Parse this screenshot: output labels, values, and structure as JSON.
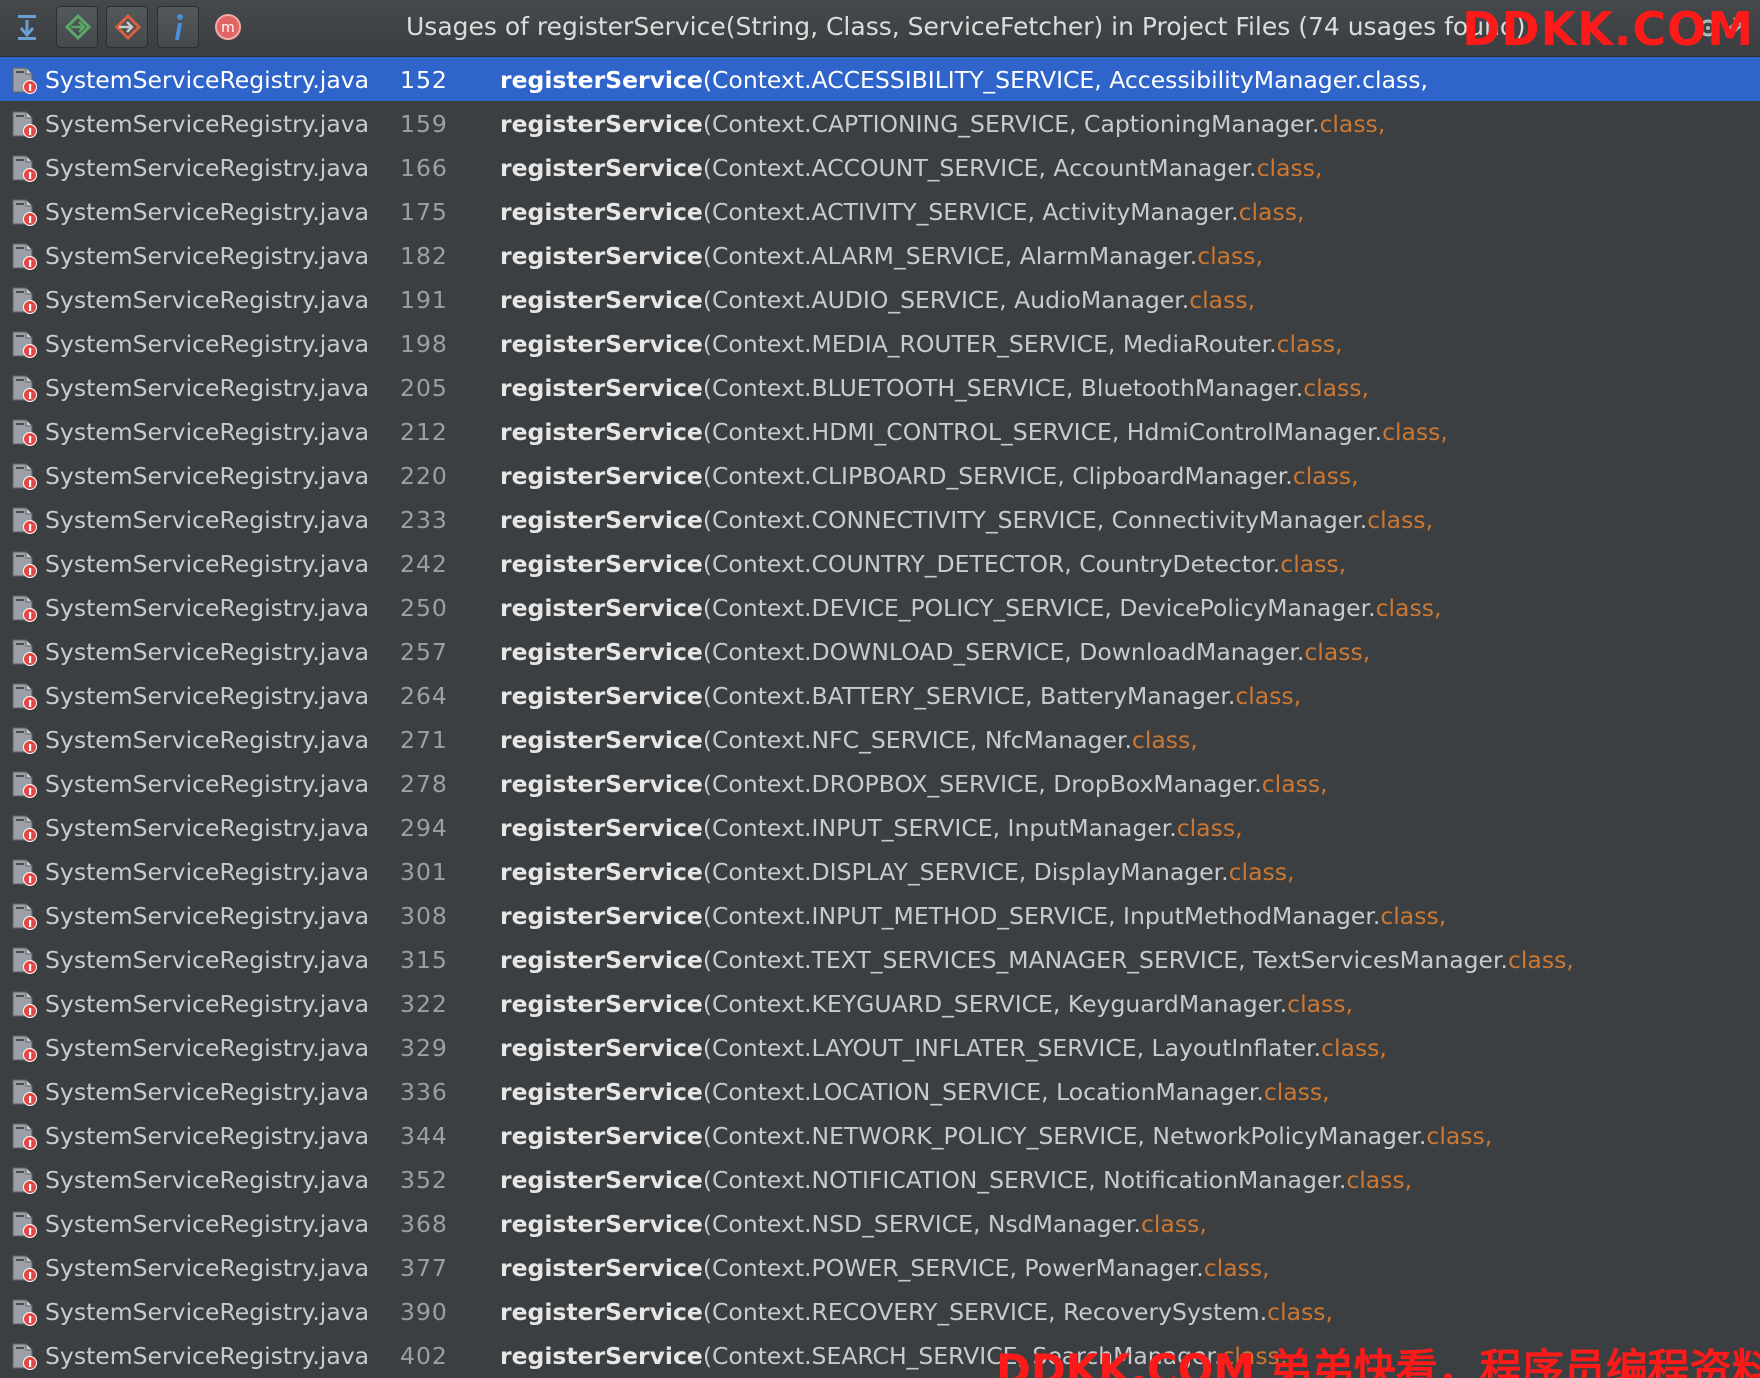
{
  "popup": {
    "title": "Usages of registerService(String, Class, ServiceFetcher) in Project Files (74 usages found)"
  },
  "toolbar": {
    "buttons": [
      {
        "name": "collapse-all-icon",
        "color": "#6a9fd4"
      },
      {
        "name": "go-to-next-icon",
        "color": "#59a869"
      },
      {
        "name": "go-to-previous-icon",
        "color": "#d9603f"
      },
      {
        "name": "info-icon",
        "color": "#4a8fd8"
      },
      {
        "name": "method-icon",
        "color": "#e06666"
      }
    ]
  },
  "watermarks": {
    "top": "DDKK.COM",
    "bottom": "DDKK.COM 弟弟快看，程序员编程资料站"
  },
  "colors": {
    "selection": "#2f65ca",
    "keyword": "#cc7832",
    "background": "#3c3f41"
  },
  "usages": [
    {
      "file": "SystemServiceRegistry.java",
      "line": "152",
      "method": "registerService",
      "args": "(Context.ACCESSIBILITY_SERVICE, AccessibilityManager.",
      "kw": "class",
      "tail": ",",
      "selected": true
    },
    {
      "file": "SystemServiceRegistry.java",
      "line": "159",
      "method": "registerService",
      "args": "(Context.CAPTIONING_SERVICE, CaptioningManager.",
      "kw": "class",
      "tail": ","
    },
    {
      "file": "SystemServiceRegistry.java",
      "line": "166",
      "method": "registerService",
      "args": "(Context.ACCOUNT_SERVICE, AccountManager.",
      "kw": "class",
      "tail": ","
    },
    {
      "file": "SystemServiceRegistry.java",
      "line": "175",
      "method": "registerService",
      "args": "(Context.ACTIVITY_SERVICE, ActivityManager.",
      "kw": "class",
      "tail": ","
    },
    {
      "file": "SystemServiceRegistry.java",
      "line": "182",
      "method": "registerService",
      "args": "(Context.ALARM_SERVICE, AlarmManager.",
      "kw": "class",
      "tail": ","
    },
    {
      "file": "SystemServiceRegistry.java",
      "line": "191",
      "method": "registerService",
      "args": "(Context.AUDIO_SERVICE, AudioManager.",
      "kw": "class",
      "tail": ","
    },
    {
      "file": "SystemServiceRegistry.java",
      "line": "198",
      "method": "registerService",
      "args": "(Context.MEDIA_ROUTER_SERVICE, MediaRouter.",
      "kw": "class",
      "tail": ","
    },
    {
      "file": "SystemServiceRegistry.java",
      "line": "205",
      "method": "registerService",
      "args": "(Context.BLUETOOTH_SERVICE, BluetoothManager.",
      "kw": "class",
      "tail": ","
    },
    {
      "file": "SystemServiceRegistry.java",
      "line": "212",
      "method": "registerService",
      "args": "(Context.HDMI_CONTROL_SERVICE, HdmiControlManager.",
      "kw": "class",
      "tail": ","
    },
    {
      "file": "SystemServiceRegistry.java",
      "line": "220",
      "method": "registerService",
      "args": "(Context.CLIPBOARD_SERVICE, ClipboardManager.",
      "kw": "class",
      "tail": ","
    },
    {
      "file": "SystemServiceRegistry.java",
      "line": "233",
      "method": "registerService",
      "args": "(Context.CONNECTIVITY_SERVICE, ConnectivityManager.",
      "kw": "class",
      "tail": ","
    },
    {
      "file": "SystemServiceRegistry.java",
      "line": "242",
      "method": "registerService",
      "args": "(Context.COUNTRY_DETECTOR, CountryDetector.",
      "kw": "class",
      "tail": ","
    },
    {
      "file": "SystemServiceRegistry.java",
      "line": "250",
      "method": "registerService",
      "args": "(Context.DEVICE_POLICY_SERVICE, DevicePolicyManager.",
      "kw": "class",
      "tail": ","
    },
    {
      "file": "SystemServiceRegistry.java",
      "line": "257",
      "method": "registerService",
      "args": "(Context.DOWNLOAD_SERVICE, DownloadManager.",
      "kw": "class",
      "tail": ","
    },
    {
      "file": "SystemServiceRegistry.java",
      "line": "264",
      "method": "registerService",
      "args": "(Context.BATTERY_SERVICE, BatteryManager.",
      "kw": "class",
      "tail": ","
    },
    {
      "file": "SystemServiceRegistry.java",
      "line": "271",
      "method": "registerService",
      "args": "(Context.NFC_SERVICE, NfcManager.",
      "kw": "class",
      "tail": ","
    },
    {
      "file": "SystemServiceRegistry.java",
      "line": "278",
      "method": "registerService",
      "args": "(Context.DROPBOX_SERVICE, DropBoxManager.",
      "kw": "class",
      "tail": ","
    },
    {
      "file": "SystemServiceRegistry.java",
      "line": "294",
      "method": "registerService",
      "args": "(Context.INPUT_SERVICE, InputManager.",
      "kw": "class",
      "tail": ","
    },
    {
      "file": "SystemServiceRegistry.java",
      "line": "301",
      "method": "registerService",
      "args": "(Context.DISPLAY_SERVICE, DisplayManager.",
      "kw": "class",
      "tail": ","
    },
    {
      "file": "SystemServiceRegistry.java",
      "line": "308",
      "method": "registerService",
      "args": "(Context.INPUT_METHOD_SERVICE, InputMethodManager.",
      "kw": "class",
      "tail": ","
    },
    {
      "file": "SystemServiceRegistry.java",
      "line": "315",
      "method": "registerService",
      "args": "(Context.TEXT_SERVICES_MANAGER_SERVICE, TextServicesManager.",
      "kw": "class",
      "tail": ","
    },
    {
      "file": "SystemServiceRegistry.java",
      "line": "322",
      "method": "registerService",
      "args": "(Context.KEYGUARD_SERVICE, KeyguardManager.",
      "kw": "class",
      "tail": ","
    },
    {
      "file": "SystemServiceRegistry.java",
      "line": "329",
      "method": "registerService",
      "args": "(Context.LAYOUT_INFLATER_SERVICE, LayoutInflater.",
      "kw": "class",
      "tail": ","
    },
    {
      "file": "SystemServiceRegistry.java",
      "line": "336",
      "method": "registerService",
      "args": "(Context.LOCATION_SERVICE, LocationManager.",
      "kw": "class",
      "tail": ","
    },
    {
      "file": "SystemServiceRegistry.java",
      "line": "344",
      "method": "registerService",
      "args": "(Context.NETWORK_POLICY_SERVICE, NetworkPolicyManager.",
      "kw": "class",
      "tail": ","
    },
    {
      "file": "SystemServiceRegistry.java",
      "line": "352",
      "method": "registerService",
      "args": "(Context.NOTIFICATION_SERVICE, NotificationManager.",
      "kw": "class",
      "tail": ","
    },
    {
      "file": "SystemServiceRegistry.java",
      "line": "368",
      "method": "registerService",
      "args": "(Context.NSD_SERVICE, NsdManager.",
      "kw": "class",
      "tail": ","
    },
    {
      "file": "SystemServiceRegistry.java",
      "line": "377",
      "method": "registerService",
      "args": "(Context.POWER_SERVICE, PowerManager.",
      "kw": "class",
      "tail": ","
    },
    {
      "file": "SystemServiceRegistry.java",
      "line": "390",
      "method": "registerService",
      "args": "(Context.RECOVERY_SERVICE, RecoverySystem.",
      "kw": "class",
      "tail": ","
    },
    {
      "file": "SystemServiceRegistry.java",
      "line": "402",
      "method": "registerService",
      "args": "(Context.SEARCH_SERVICE, SearchManager.",
      "kw": "class",
      "tail": ","
    }
  ]
}
